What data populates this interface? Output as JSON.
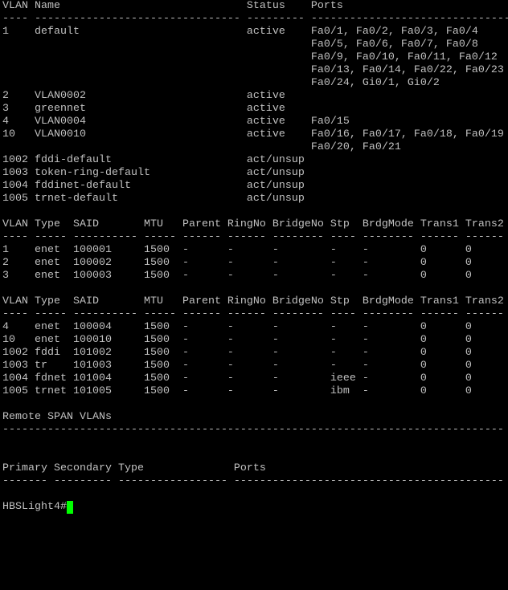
{
  "terminal": {
    "lines": [
      "VLAN Name                             Status    Ports",
      "---- -------------------------------- --------- -------------------------------",
      "1    default                          active    Fa0/1, Fa0/2, Fa0/3, Fa0/4",
      "                                                Fa0/5, Fa0/6, Fa0/7, Fa0/8",
      "                                                Fa0/9, Fa0/10, Fa0/11, Fa0/12",
      "                                                Fa0/13, Fa0/14, Fa0/22, Fa0/23",
      "                                                Fa0/24, Gi0/1, Gi0/2",
      "2    VLAN0002                         active",
      "3    greennet                         active",
      "4    VLAN0004                         active    Fa0/15",
      "10   VLAN0010                         active    Fa0/16, Fa0/17, Fa0/18, Fa0/19",
      "                                                Fa0/20, Fa0/21",
      "1002 fddi-default                     act/unsup",
      "1003 token-ring-default               act/unsup",
      "1004 fddinet-default                  act/unsup",
      "1005 trnet-default                    act/unsup",
      "",
      "VLAN Type  SAID       MTU   Parent RingNo BridgeNo Stp  BrdgMode Trans1 Trans2",
      "---- ----- ---------- ----- ------ ------ -------- ---- -------- ------ ------",
      "1    enet  100001     1500  -      -      -        -    -        0      0",
      "2    enet  100002     1500  -      -      -        -    -        0      0",
      "3    enet  100003     1500  -      -      -        -    -        0      0",
      "",
      "VLAN Type  SAID       MTU   Parent RingNo BridgeNo Stp  BrdgMode Trans1 Trans2",
      "---- ----- ---------- ----- ------ ------ -------- ---- -------- ------ ------",
      "4    enet  100004     1500  -      -      -        -    -        0      0",
      "10   enet  100010     1500  -      -      -        -    -        0      0",
      "1002 fddi  101002     1500  -      -      -        -    -        0      0",
      "1003 tr    101003     1500  -      -      -        -    -        0      0",
      "1004 fdnet 101004     1500  -      -      -        ieee -        0      0",
      "1005 trnet 101005     1500  -      -      -        ibm  -        0      0",
      "",
      "Remote SPAN VLANs",
      "------------------------------------------------------------------------------",
      "",
      "",
      "Primary Secondary Type              Ports",
      "------- --------- ----------------- ------------------------------------------",
      "",
      "HBSLight4#"
    ],
    "colors": {
      "background": "#000000",
      "text": "#c0c0c0",
      "cursor": "#00ff00"
    }
  }
}
